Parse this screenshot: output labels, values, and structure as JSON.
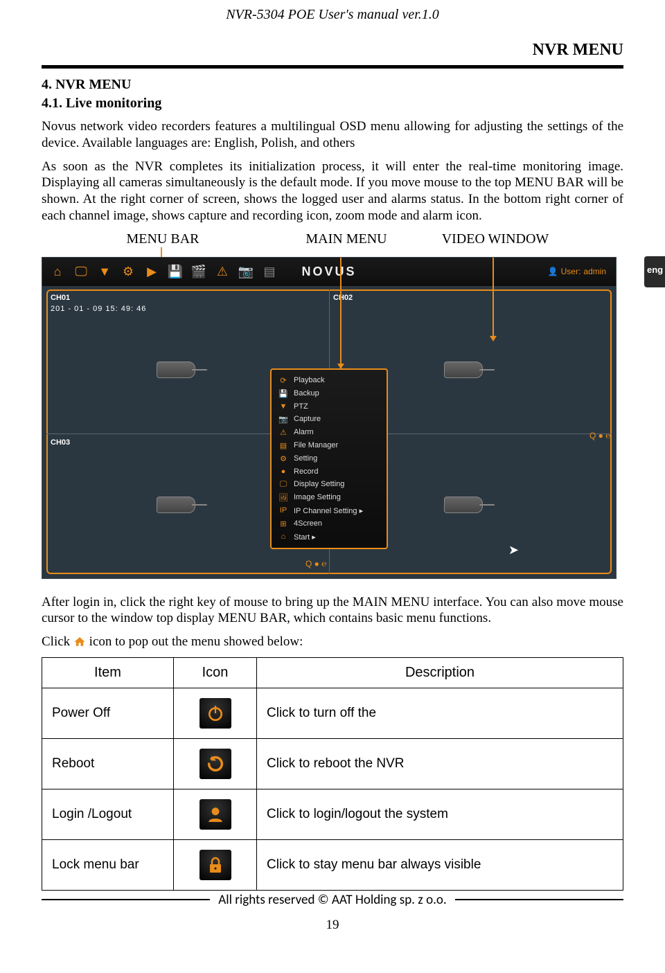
{
  "doc_header": "NVR-5304 POE User's manual ver.1.0",
  "page_title": "NVR MENU",
  "section_num": "4. NVR MENU",
  "subsection_num": "4.1. Live monitoring",
  "para1": "Novus network video recorders features a multilingual OSD menu allowing for adjusting the settings of the device. Available languages are: English, Polish, and others",
  "para2": "As soon as the NVR completes its initialization process, it will enter the real-time monitoring image. Displaying all cameras simultaneously is the default mode. If you move mouse to the top MENU BAR will be shown. At the right corner of screen, shows the logged user and alarms status. In the bottom right corner of each channel image, shows capture and recording icon, zoom mode and alarm icon.",
  "lang_tab": "eng",
  "annot": {
    "menu_bar": "MENU BAR",
    "main_menu": "MAIN MENU",
    "video_window": "VIDEO WINDOW"
  },
  "nvr": {
    "logo": "NOVUS",
    "user_prefix": "User:",
    "user_name": "admin",
    "ch01": "CH01",
    "ch02": "CH02",
    "ch03": "CH03",
    "timestamp": "201  - 01 - 09  15: 49: 46",
    "status_qre": "Q  ●  ℮",
    "menu_items": [
      {
        "icon": "⟳",
        "label": "Playback"
      },
      {
        "icon": "💾",
        "label": "Backup"
      },
      {
        "icon": "▼",
        "label": "PTZ"
      },
      {
        "icon": "📷",
        "label": "Capture"
      },
      {
        "icon": "⚠",
        "label": "Alarm"
      },
      {
        "icon": "▤",
        "label": "File Manager"
      },
      {
        "icon": "⚙",
        "label": "Setting"
      },
      {
        "icon": "●",
        "label": "Record"
      },
      {
        "icon": "🖵",
        "label": "Display Setting"
      },
      {
        "icon": "🖼",
        "label": "Image Setting"
      },
      {
        "icon": "IP",
        "label": "IP Channel Setting   ▸"
      },
      {
        "icon": "⊞",
        "label": "4Screen"
      },
      {
        "icon": "⌂",
        "label": "Start                          ▸"
      }
    ]
  },
  "para3": "After login in, click the right key of mouse to bring up the MAIN MENU interface. You can also move mouse cursor to the window top display MENU BAR, which contains basic menu functions.",
  "click_line_a": "Click ",
  "click_line_b": " icon to pop out the menu showed below:",
  "table": {
    "headers": [
      "Item",
      "Icon",
      "Description"
    ],
    "rows": [
      {
        "item": "Power Off",
        "icon": "power",
        "desc": "Click to turn off the"
      },
      {
        "item": "Reboot",
        "icon": "reboot",
        "desc": "Click to reboot the NVR"
      },
      {
        "item": "Login /Logout",
        "icon": "user",
        "desc": "Click to login/logout the system"
      },
      {
        "item": "Lock menu bar",
        "icon": "lock",
        "desc": "Click to stay menu bar always visible"
      }
    ]
  },
  "footer": "All rights reserved © AAT Holding sp. z o.o.",
  "page_number": "19"
}
